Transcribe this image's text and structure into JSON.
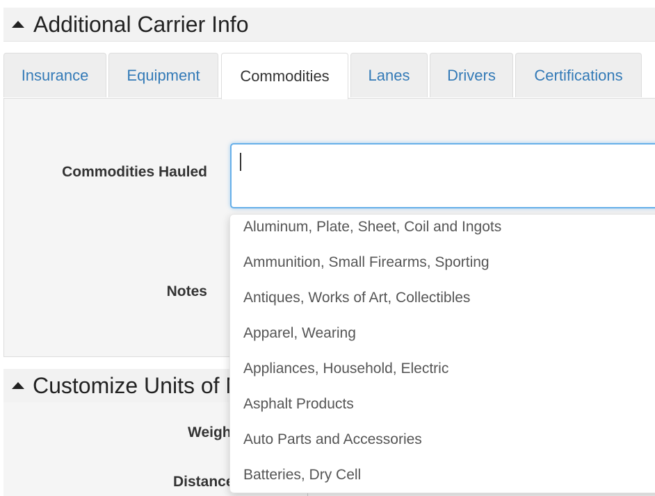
{
  "section_additional": {
    "title": "Additional Carrier Info"
  },
  "tabs": [
    {
      "label": "Insurance"
    },
    {
      "label": "Equipment"
    },
    {
      "label": "Commodities",
      "active": true
    },
    {
      "label": "Lanes"
    },
    {
      "label": "Drivers"
    },
    {
      "label": "Certifications"
    }
  ],
  "form": {
    "commodities_label": "Commodities Hauled",
    "commodities_value": "",
    "notes_label": "Notes"
  },
  "dropdown": {
    "options": [
      "Aluminum, Plate, Sheet, Coil and Ingots",
      "Ammunition, Small Firearms, Sporting",
      "Antiques, Works of Art, Collectibles",
      "Apparel, Wearing",
      "Appliances, Household, Electric",
      "Asphalt Products",
      "Auto Parts and Accessories",
      "Batteries, Dry Cell"
    ]
  },
  "section_units": {
    "title": "Customize Units of Measure",
    "weight_label": "Weight",
    "distance_label": "Distance"
  },
  "colors": {
    "link": "#337ab7",
    "focus_border": "#66afe9",
    "header_bg": "#f2f2f2"
  }
}
